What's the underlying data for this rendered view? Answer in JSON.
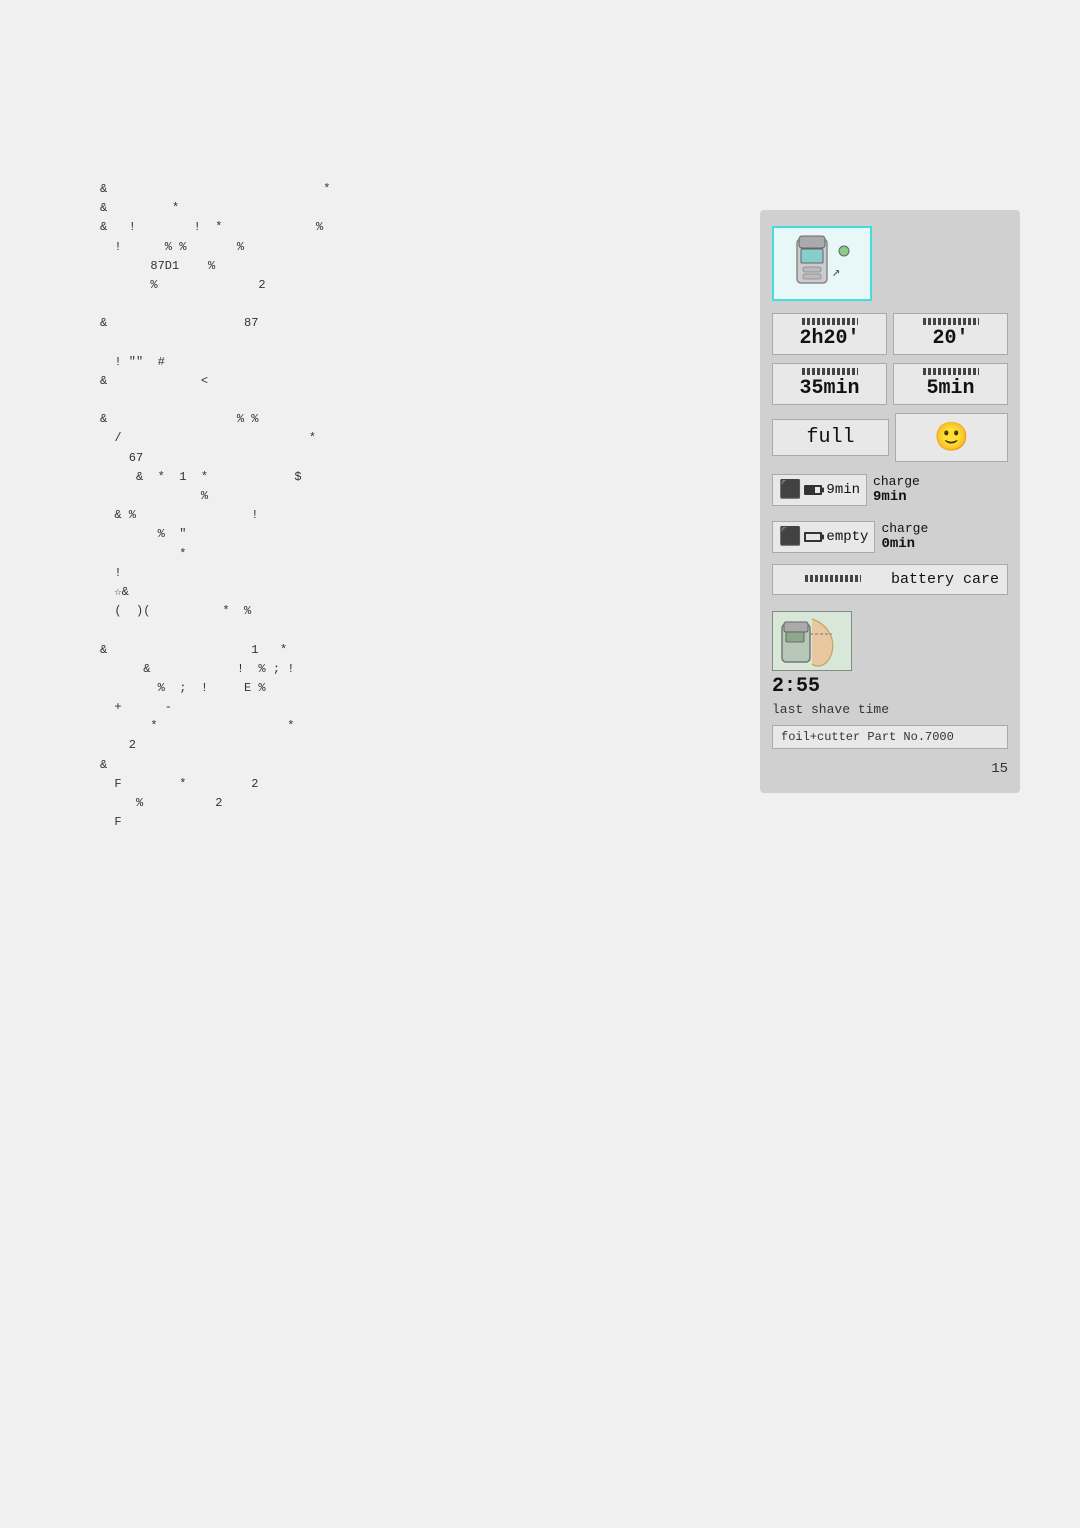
{
  "left_panel": {
    "lines": [
      "&                              *",
      "&         *",
      "&         !     * ! *        %",
      "  !       % %        %",
      "          87D1   %",
      "          %              2",
      "",
      "&                   87",
      "",
      "  ! \"\"  #",
      "&             <",
      "",
      "&                  % %",
      "  /                          *",
      "    67",
      "     &  *  1  *            $",
      "              %",
      "  & %                !",
      "        %  \"",
      "           *",
      "  !",
      "  ☆&",
      "  (  )(          *  %",
      "",
      "&                    1   *",
      "      &            !  % ; !",
      "        %  ;  !     E %",
      "  +      -",
      "       *                  *",
      "    2",
      "&",
      "  F        *         2",
      "     %          2",
      "  F"
    ]
  },
  "right_panel": {
    "device_alt": "Shaver device illustration",
    "rows": [
      {
        "type": "time_pair",
        "left": {
          "bar": true,
          "value": "2h20'",
          "size": "large"
        },
        "right": {
          "bar": true,
          "value": "20'",
          "size": "large"
        }
      },
      {
        "type": "time_pair",
        "left": {
          "bar": true,
          "value": "35min",
          "size": "medium"
        },
        "right": {
          "bar": true,
          "value": "5min",
          "size": "medium"
        }
      },
      {
        "type": "full_smiley",
        "left": {
          "value": "full"
        },
        "right": {
          "value": "🙂"
        }
      },
      {
        "type": "charge_row",
        "left_time": "9min",
        "charge_label": "charge",
        "charge_time": "9min"
      },
      {
        "type": "charge_row_empty",
        "left_time": "empty",
        "charge_label": "charge",
        "charge_time": "0min"
      }
    ],
    "battery_care": "battery care",
    "shave_time": "2:55",
    "shave_label": "last shave time",
    "foil_label": "foil+cutter",
    "part_no": "Part No.7000",
    "page_number": "15"
  }
}
